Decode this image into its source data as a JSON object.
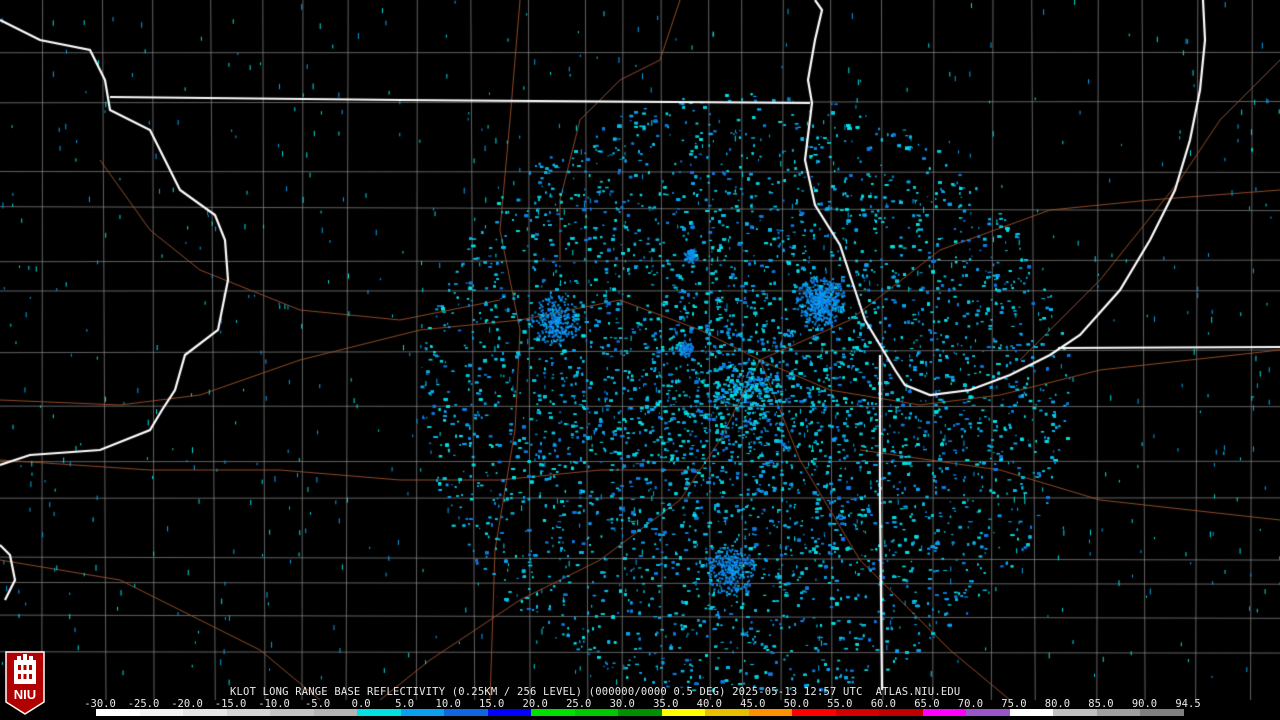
{
  "product_title": "KLOT LONG RANGE BASE REFLECTIVITY (0.25KM / 256 LEVEL) (000000/0000 0.5 DEG) 2025-05-13 12:57 UTC  ATLAS.NIU.EDU",
  "scale": {
    "labels": [
      "-30.0",
      "-25.0",
      "-20.0",
      "-15.0",
      "-10.0",
      "-5.0",
      "0.0",
      "5.0",
      "10.0",
      "15.0",
      "20.0",
      "25.0",
      "30.0",
      "35.0",
      "40.0",
      "45.0",
      "50.0",
      "55.0",
      "60.0",
      "65.0",
      "70.0",
      "75.0",
      "80.0",
      "85.0",
      "90.0",
      "94.5"
    ],
    "colors": [
      "#ffffff",
      "#f2f2f2",
      "#e4e4e4",
      "#d4d4d4",
      "#c4c4c4",
      "#b4b4b4",
      "#02e0e0",
      "#0aa0f0",
      "#1066e0",
      "#0000ff",
      "#00e000",
      "#00c800",
      "#009000",
      "#ffff00",
      "#e8c000",
      "#ff9000",
      "#ff0000",
      "#d40000",
      "#c00000",
      "#ff00ff",
      "#9955c9",
      "#ffffff",
      "#c0c0c0",
      "#a0a0a0",
      "#808080"
    ]
  },
  "logo": {
    "text": "NIU",
    "icon": "niu-logo-icon",
    "colors": {
      "background": "#b00000",
      "text": "#ffffff"
    }
  },
  "map": {
    "style_colors": {
      "background": "#000000",
      "state_border": "#ffffff",
      "county_line": "#8c8c8c",
      "road": "#a0522d"
    }
  }
}
